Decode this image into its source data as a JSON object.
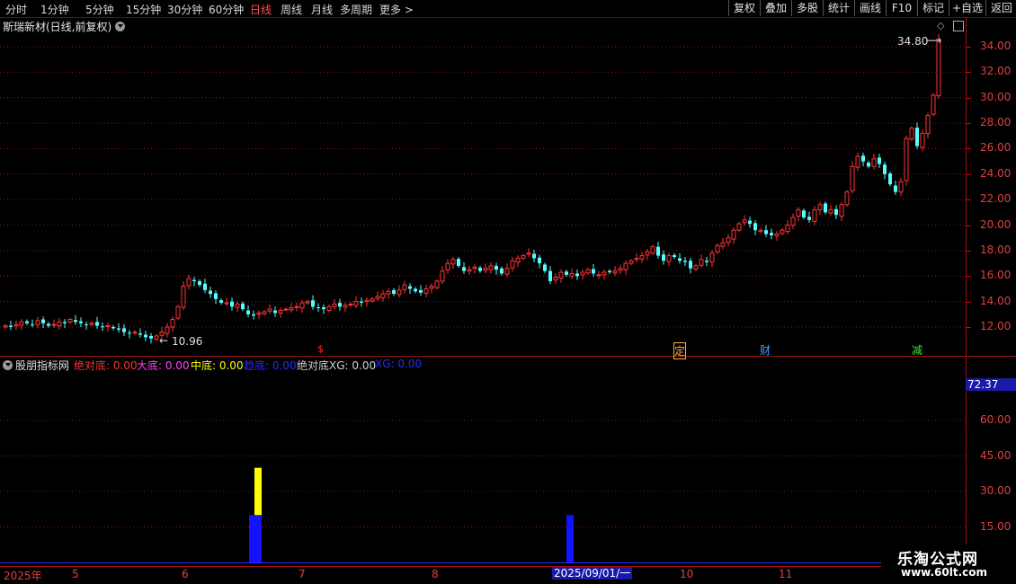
{
  "toolbar": {
    "periods": [
      "分时",
      "1分钟",
      "5分钟",
      "15分钟",
      "30分钟",
      "60分钟",
      "日线",
      "周线",
      "月线",
      "多周期",
      "更多 >"
    ],
    "active_period": "日线",
    "buttons": [
      "复权",
      "叠加",
      "多股",
      "统计",
      "画线",
      "F10",
      "+自选",
      "返回"
    ],
    "right_extra": "标记"
  },
  "stock": {
    "title": "斯瑞新材(日线,前复权)",
    "high_label": "34.80",
    "low_label": "10.96"
  },
  "price_axis": [
    "34.00",
    "32.00",
    "30.00",
    "28.00",
    "26.00",
    "24.00",
    "22.00",
    "20.00",
    "18.00",
    "16.00",
    "14.00",
    "12.00"
  ],
  "markers": [
    {
      "text": "$",
      "color": "#ff3030"
    },
    {
      "text": "定",
      "color": "#ffb040"
    },
    {
      "text": "财",
      "color": "#40a0ff"
    },
    {
      "text": "减",
      "color": "#40e040"
    }
  ],
  "indicator": {
    "name": "股朋指标网",
    "items": [
      {
        "label": "绝对底: 0.00",
        "color": "#ff3030"
      },
      {
        "label": "大底: 0.00",
        "color": "#ff40ff"
      },
      {
        "label": "中底: 0.00",
        "color": "#ffff00"
      },
      {
        "label": "趋底: 0.00",
        "color": "#2a2aff"
      },
      {
        "label": "绝对底XG: 0.00",
        "color": "#d0d0d0"
      },
      {
        "label": "XG: 0.00",
        "color": "#2a2aff"
      }
    ],
    "current_value": "72.37",
    "axis": [
      "60.00",
      "45.00",
      "30.00",
      "15.00"
    ],
    "bars": [
      {
        "date_index": 0,
        "blue": 20,
        "yellow": 40
      },
      {
        "date_index": 1,
        "blue": 20,
        "yellow": 0
      }
    ]
  },
  "date_axis": {
    "labels": [
      "2025年",
      "5",
      "6",
      "7",
      "8",
      "10",
      "11"
    ],
    "cursor_date": "2025/09/01/一"
  },
  "colors": {
    "up": "#ff3333",
    "down": "#54ffff",
    "grid": "#8b1a1a"
  },
  "watermark": {
    "line1": "乐淘公式网",
    "line2": "www.60lt.com"
  }
}
